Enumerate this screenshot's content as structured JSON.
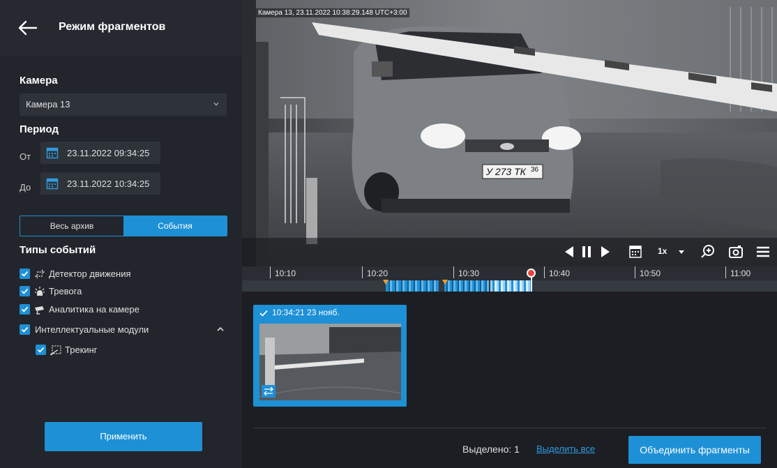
{
  "header": {
    "title": "Режим фрагментов",
    "back_icon": "arrow-left-icon"
  },
  "camera": {
    "label": "Камера",
    "selected": "Камера 13"
  },
  "period": {
    "label": "Период",
    "from_label": "От",
    "from_value": "23.11.2022  09:34:25",
    "to_label": "До",
    "to_value": "23.11.2022  10:34:25"
  },
  "mode": {
    "options": [
      "Весь архив",
      "События"
    ],
    "active": "События"
  },
  "event_types": {
    "label": "Типы событий",
    "items": [
      {
        "label": "Детектор движения",
        "icon": "motion-detector-icon",
        "checked": true
      },
      {
        "label": "Тревога",
        "icon": "alarm-icon",
        "checked": true
      },
      {
        "label": "Аналитика на камере",
        "icon": "camera-analytics-icon",
        "checked": true
      },
      {
        "label": "Интеллектуальные модули",
        "checked": true,
        "expanded": true
      },
      {
        "label": "Трекинг",
        "icon": "tracking-icon",
        "checked": true
      }
    ]
  },
  "apply_label": "Применить",
  "video": {
    "overlay": "Камера 13, 23.11.2022 10:38:29.148 UTC+3:00",
    "plate": "У 273 ТК",
    "plate_region": "36",
    "speed": "1x"
  },
  "timeline": {
    "ticks": [
      "10:10",
      "10:20",
      "10:30",
      "10:40",
      "10:50",
      "11:00"
    ]
  },
  "fragment": {
    "title": "10:34:21 23 нояб.",
    "selected": true
  },
  "footer": {
    "selected_text": "Выделено: 1",
    "select_all": "Выделить все",
    "merge_label": "Объединить фрагменты"
  },
  "colors": {
    "accent": "#1e90d6",
    "marker": "#f29b2f",
    "playhead": "#e9443b"
  }
}
